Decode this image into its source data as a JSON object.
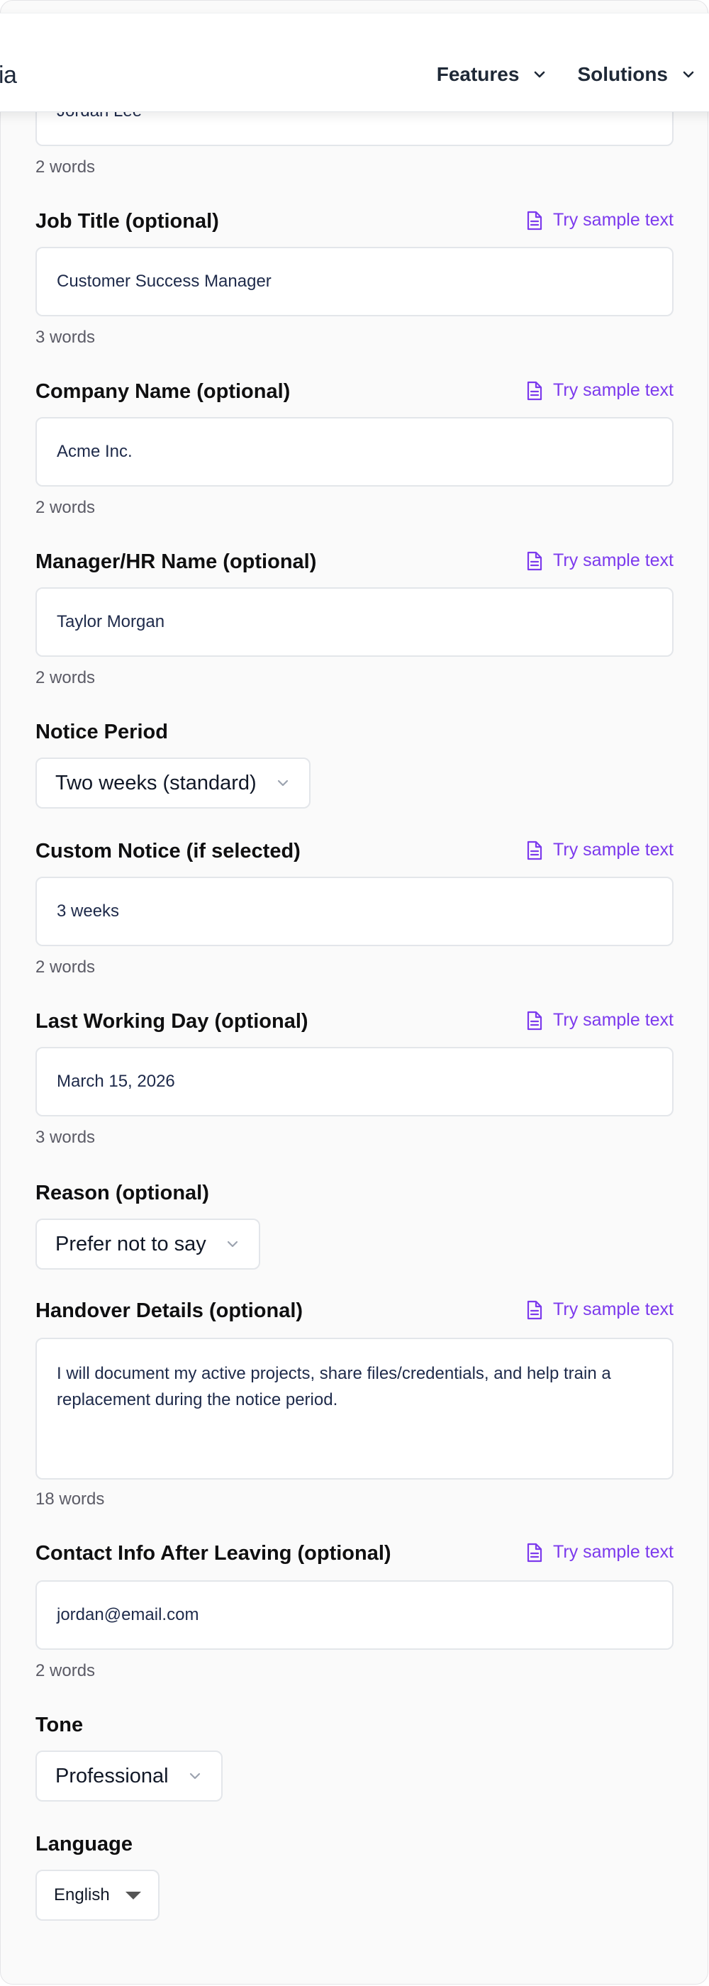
{
  "header": {
    "logo_fragment": "ia",
    "nav": [
      {
        "label": "Features"
      },
      {
        "label": "Solutions"
      }
    ]
  },
  "form": {
    "name_field": {
      "value": "Jordan Lee",
      "word_count": "2 words"
    },
    "job_title": {
      "label": "Job Title (optional)",
      "sample": "Try sample text",
      "value": "Customer Success Manager",
      "word_count": "3 words"
    },
    "company": {
      "label": "Company Name (optional)",
      "sample": "Try sample text",
      "value": "Acme Inc.",
      "word_count": "2 words"
    },
    "manager": {
      "label": "Manager/HR Name (optional)",
      "sample": "Try sample text",
      "value": "Taylor Morgan",
      "word_count": "2 words"
    },
    "notice_period": {
      "label": "Notice Period",
      "selected": "Two weeks (standard)"
    },
    "custom_notice": {
      "label": "Custom Notice (if selected)",
      "sample": "Try sample text",
      "value": "3 weeks",
      "word_count": "2 words"
    },
    "last_day": {
      "label": "Last Working Day (optional)",
      "sample": "Try sample text",
      "value": "March 15, 2026",
      "word_count": "3 words"
    },
    "reason": {
      "label": "Reason (optional)",
      "selected": "Prefer not to say"
    },
    "handover": {
      "label": "Handover Details (optional)",
      "sample": "Try sample text",
      "value": "I will document my active projects, share files/credentials, and help train a replacement during the notice period.",
      "word_count": "18 words"
    },
    "contact": {
      "label": "Contact Info After Leaving (optional)",
      "sample": "Try sample text",
      "value": "jordan@email.com",
      "word_count": "2 words"
    },
    "tone": {
      "label": "Tone",
      "selected": "Professional"
    },
    "language": {
      "label": "Language",
      "selected": "English"
    }
  },
  "colors": {
    "accent": "#7c3aed",
    "page_bg": "#fafafa",
    "text": "#111827",
    "muted": "#5b5b66"
  },
  "icons": {
    "sample": "document-icon",
    "dropdown": "chevron-down-icon"
  }
}
